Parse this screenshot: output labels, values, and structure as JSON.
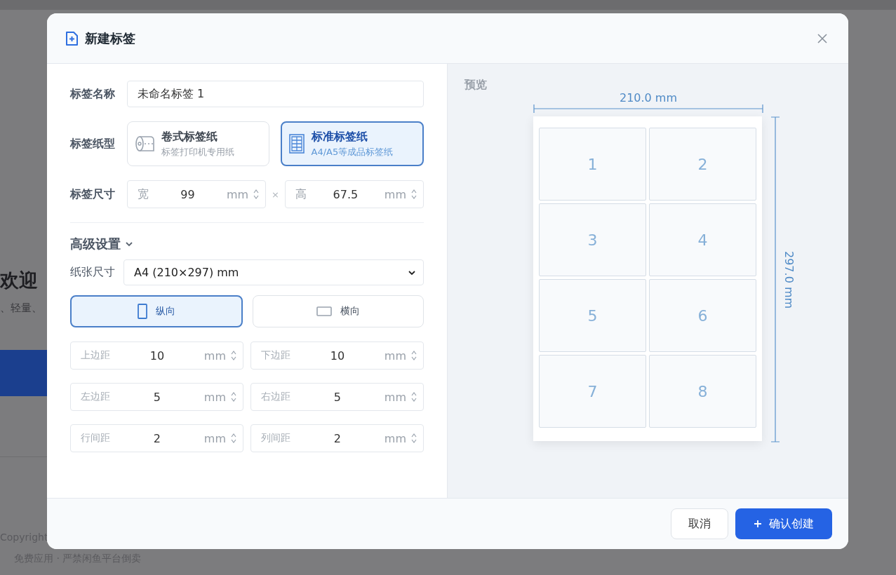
{
  "background": {
    "heading": "欢迎",
    "subtitle": "、轻量、",
    "copyright": "Copyright",
    "notice": "免费应用 · 严禁闲鱼平台倒卖"
  },
  "dialog": {
    "title": "新建标签",
    "form": {
      "name": {
        "label": "标签名称",
        "value": "未命名标签 1"
      },
      "paper_type": {
        "label": "标签纸型",
        "options": [
          {
            "kind": "roll",
            "title": "卷式标签纸",
            "subtitle": "标签打印机专用纸",
            "selected": false
          },
          {
            "kind": "sheet",
            "title": "标准标签纸",
            "subtitle": "A4/A5等成品标签纸",
            "selected": true
          }
        ]
      },
      "size": {
        "label": "标签尺寸",
        "separator": "×",
        "fields": [
          {
            "prefix": "宽",
            "value": "99",
            "unit": "mm"
          },
          {
            "prefix": "高",
            "value": "67.5",
            "unit": "mm"
          }
        ]
      },
      "advanced": {
        "title": "高级设置",
        "expanded": true,
        "paper_size": {
          "label": "纸张尺寸",
          "value": "A4 (210×297) mm"
        },
        "orientations": [
          {
            "kind": "portrait",
            "label": "纵向",
            "selected": true
          },
          {
            "kind": "landscape",
            "label": "横向",
            "selected": false
          }
        ],
        "spacing": [
          {
            "label": "上边距",
            "value": "10",
            "unit": "mm"
          },
          {
            "label": "下边距",
            "value": "10",
            "unit": "mm"
          },
          {
            "label": "左边距",
            "value": "5",
            "unit": "mm"
          },
          {
            "label": "右边距",
            "value": "5",
            "unit": "mm"
          },
          {
            "label": "行间距",
            "value": "2",
            "unit": "mm"
          },
          {
            "label": "列间距",
            "value": "2",
            "unit": "mm"
          }
        ]
      }
    },
    "preview": {
      "title": "预览",
      "width_label": "210.0 mm",
      "height_label": "297.0 mm",
      "labels": [
        "1",
        "2",
        "3",
        "4",
        "5",
        "6",
        "7",
        "8"
      ]
    },
    "buttons": [
      {
        "kind": "secondary",
        "label": "取消"
      },
      {
        "kind": "primary",
        "label": "确认创建"
      }
    ]
  }
}
